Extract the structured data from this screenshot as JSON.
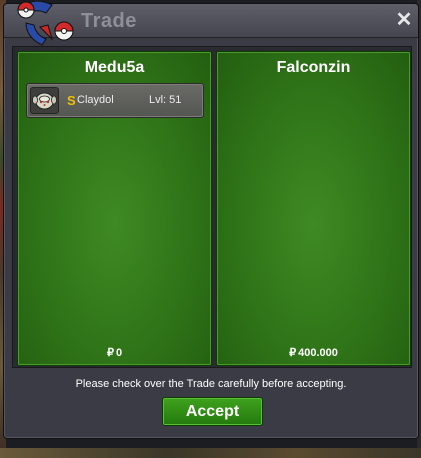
{
  "window": {
    "title": "Trade",
    "close_label": "✕"
  },
  "trade": {
    "left": {
      "player_name": "Medu5a",
      "items": [
        {
          "shiny_marker": "S",
          "name": "Claydol",
          "level": "Lvl: 51",
          "icon": "claydol-icon"
        }
      ],
      "money_symbol": "₽",
      "money": "0"
    },
    "right": {
      "player_name": "Falconzin",
      "items": [],
      "money_symbol": "₽",
      "money": "400.000"
    }
  },
  "footer": {
    "notice": "Please check over the Trade carefully before accepting.",
    "accept_label": "Accept"
  },
  "colors": {
    "panel_green": "#2f7418",
    "accept_green": "#3fa21d",
    "shiny_gold": "#f0c000",
    "window_bg": "#3a3b44"
  }
}
